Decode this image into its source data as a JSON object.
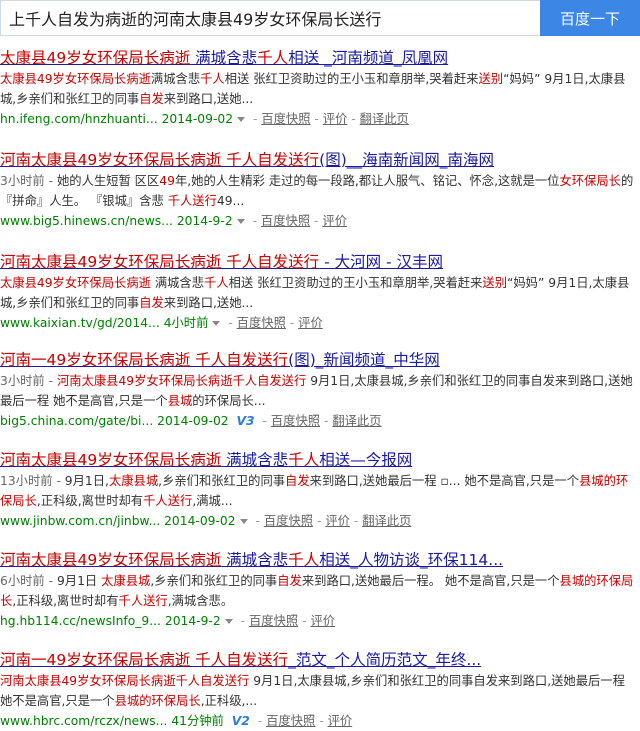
{
  "search": {
    "query": "上千人自发为病逝的河南太康县49岁女环保局长送行",
    "button_label": "百度一下"
  },
  "results": [
    {
      "title": [
        {
          "t": "太康县49岁女环保局长病逝",
          "hl": true
        },
        {
          "t": " 满城含悲",
          "hl": false
        },
        {
          "t": "千人",
          "hl": true
        },
        {
          "t": "相送 _河南频道_凤凰网",
          "hl": false
        }
      ],
      "abstract": [
        {
          "t": "太康县49岁女环保局长病逝",
          "hl": true
        },
        {
          "t": "满城含悲",
          "hl": false
        },
        {
          "t": "千人",
          "hl": true
        },
        {
          "t": "相送 张红卫资助过的王小玉和章朋举,哭着赶来",
          "hl": false
        },
        {
          "t": "送别",
          "hl": true
        },
        {
          "t": "“妈妈” 9月1日,太康县城,乡亲们和张红卫的同事",
          "hl": false
        },
        {
          "t": "自发",
          "hl": true
        },
        {
          "t": "来到路口,送她...",
          "hl": false
        }
      ],
      "url": "hn.ifeng.com/hnzhuanti...",
      "date": "2014-09-02",
      "badge": "",
      "links": [
        "百度快照",
        "评价",
        "翻译此页"
      ]
    },
    {
      "title": [
        {
          "t": "河南太康县49岁女环保局长病逝 千人自发送行",
          "hl": true
        },
        {
          "t": "(图)__海南新闻网_南海网",
          "hl": false
        }
      ],
      "abstract": [
        {
          "t": "3小时前 - ",
          "hl": false,
          "date": true
        },
        {
          "t": "她的人生短暂 区区",
          "hl": false
        },
        {
          "t": "49",
          "hl": true
        },
        {
          "t": "年,她的人生精彩 走过的每一段路,都让人服气、铭记、怀念,这就是一位",
          "hl": false
        },
        {
          "t": "女环保局长",
          "hl": true
        },
        {
          "t": "的『拼命』人生。 『银城』含悲 ",
          "hl": false
        },
        {
          "t": "千人送行",
          "hl": true
        },
        {
          "t": "49...",
          "hl": false
        }
      ],
      "url": "www.big5.hinews.cn/news...",
      "date": "2014-9-2",
      "badge": "",
      "links": [
        "百度快照",
        "评价"
      ]
    },
    {
      "title": [
        {
          "t": "河南太康县49岁女环保局长病逝 千人自发送行",
          "hl": true
        },
        {
          "t": " - 大河网 - 汉丰网",
          "hl": false
        }
      ],
      "abstract": [
        {
          "t": "太康县49岁女环保局长病逝",
          "hl": true
        },
        {
          "t": " 满城含悲",
          "hl": false
        },
        {
          "t": "千人",
          "hl": true
        },
        {
          "t": "相送 张红卫资助过的王小玉和章朋举,哭着赶来",
          "hl": false
        },
        {
          "t": "送别",
          "hl": true
        },
        {
          "t": "“妈妈” 9月1日,太康县城,乡亲们和张红卫的同事",
          "hl": false
        },
        {
          "t": "自发",
          "hl": true
        },
        {
          "t": "来到路口,送她...",
          "hl": false
        }
      ],
      "url": "www.kaixian.tv/gd/2014...",
      "date": "4小时前",
      "badge": "",
      "links": [
        "百度快照",
        "评价"
      ]
    },
    {
      "title": [
        {
          "t": "河南一49岁女环保局长病逝 千人自发送行",
          "hl": true
        },
        {
          "t": "(图)_新闻频道_中华网",
          "hl": false
        }
      ],
      "abstract": [
        {
          "t": "3小时前 - ",
          "hl": false,
          "date": true
        },
        {
          "t": "河南太康县49岁女环保局长病逝千人自发送行",
          "hl": true
        },
        {
          "t": " 9月1日,太康县城,乡亲们和张红卫的同事自发来到路口,送她最后一程 她不是高官,只是一个",
          "hl": false
        },
        {
          "t": "县城",
          "hl": true
        },
        {
          "t": "的环保局长...",
          "hl": false
        }
      ],
      "url": "big5.china.com/gate/bi...",
      "date": "2014-09-02",
      "badge": "V3",
      "links": [
        "百度快照",
        "翻译此页"
      ]
    },
    {
      "title": [
        {
          "t": "河南太康县49岁女环保局长病逝",
          "hl": true
        },
        {
          "t": " 满城含悲",
          "hl": false
        },
        {
          "t": "千人",
          "hl": true
        },
        {
          "t": "相送—今报网",
          "hl": false
        }
      ],
      "abstract": [
        {
          "t": "13小时前 - ",
          "hl": false,
          "date": true
        },
        {
          "t": "9月1日,",
          "hl": false
        },
        {
          "t": "太康县城",
          "hl": true
        },
        {
          "t": ",乡亲们和张红卫的同事",
          "hl": false
        },
        {
          "t": "自发",
          "hl": true
        },
        {
          "t": "来到路口,送她最后一程 ▫... 她不是高官,只是一个",
          "hl": false
        },
        {
          "t": "县城的环保局长",
          "hl": true
        },
        {
          "t": ",正科级,离世时却有",
          "hl": false
        },
        {
          "t": "千人送行",
          "hl": true
        },
        {
          "t": ",满城...",
          "hl": false
        }
      ],
      "url": "www.jinbw.com.cn/jinbw...",
      "date": "2014-09-02",
      "badge": "",
      "links": [
        "百度快照",
        "评价",
        "翻译此页"
      ]
    },
    {
      "title": [
        {
          "t": "河南太康县49岁女环保局长病逝",
          "hl": true
        },
        {
          "t": " 满城含悲",
          "hl": false
        },
        {
          "t": "千人",
          "hl": true
        },
        {
          "t": "相送_人物访谈_环保114...",
          "hl": false
        }
      ],
      "abstract": [
        {
          "t": "6小时前 - ",
          "hl": false,
          "date": true
        },
        {
          "t": "9月1日 ",
          "hl": false
        },
        {
          "t": "太康县城",
          "hl": true
        },
        {
          "t": ",乡亲们和张红卫的同事",
          "hl": false
        },
        {
          "t": "自发",
          "hl": true
        },
        {
          "t": "来到路口,送她最后一程。 她不是高官,只是一个",
          "hl": false
        },
        {
          "t": "县城的环保局长",
          "hl": true
        },
        {
          "t": ",正科级,离世时却有",
          "hl": false
        },
        {
          "t": "千人送行",
          "hl": true
        },
        {
          "t": ",满城含悲。",
          "hl": false
        }
      ],
      "url": "hg.hb114.cc/newsInfo_9...",
      "date": "2014-9-2",
      "badge": "",
      "links": [
        "百度快照",
        "评价"
      ]
    },
    {
      "title": [
        {
          "t": "河南一49岁女环保局长病逝 千人自发送行",
          "hl": true
        },
        {
          "t": "_范文_个人简历范文_年终...",
          "hl": false
        }
      ],
      "abstract": [
        {
          "t": "河南太康县49岁女环保局长病逝千人自发送行",
          "hl": true
        },
        {
          "t": " 9月1日,太康县城,乡亲们和张红卫的同事自发来到路口,送她最后一程 她不是高官,只是一个",
          "hl": false
        },
        {
          "t": "县城的环保局长",
          "hl": true
        },
        {
          "t": ",正科级,...",
          "hl": false
        }
      ],
      "url": "www.hbrc.com/rczx/news...",
      "date": "41分钟前",
      "badge": "V2",
      "links": [
        "百度快照",
        "评价"
      ]
    }
  ]
}
